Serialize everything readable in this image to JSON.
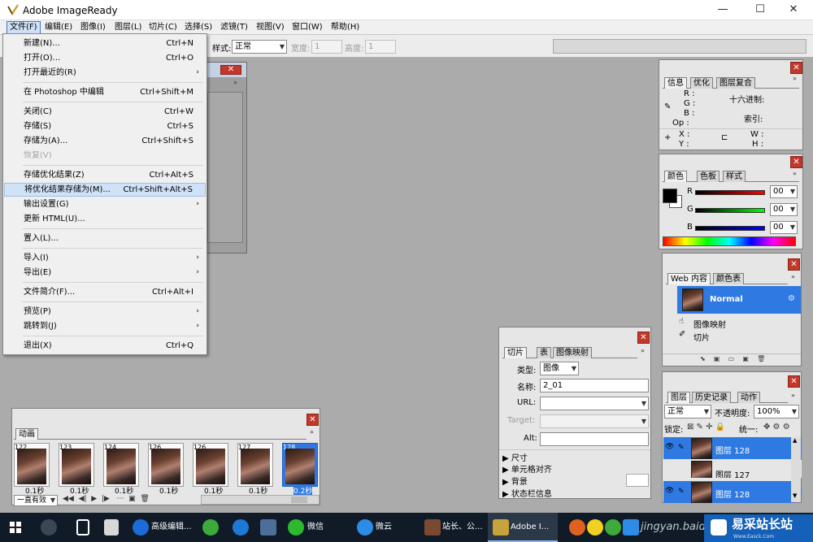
{
  "window": {
    "title": "Adobe ImageReady",
    "min": "—",
    "max": "☐",
    "close": "✕"
  },
  "menubar": [
    "文件(F)",
    "编辑(E)",
    "图像(I)",
    "图层(L)",
    "切片(C)",
    "选择(S)",
    "滤镜(T)",
    "视图(V)",
    "窗口(W)",
    "帮助(H)"
  ],
  "options": {
    "style_label": "样式:",
    "style_value": "正常",
    "width_label": "宽度:",
    "width_value": "1",
    "height_label": "高度:",
    "height_value": "1"
  },
  "file_menu": [
    {
      "label": "新建(N)...",
      "shortcut": "Ctrl+N"
    },
    {
      "label": "打开(O)...",
      "shortcut": "Ctrl+O"
    },
    {
      "label": "打开最近的(R)",
      "arrow": "›"
    },
    {
      "label": "在 Photoshop 中编辑",
      "shortcut": "Ctrl+Shift+M"
    },
    {
      "label": "关闭(C)",
      "shortcut": "Ctrl+W"
    },
    {
      "label": "存储(S)",
      "shortcut": "Ctrl+S"
    },
    {
      "label": "存储为(A)...",
      "shortcut": "Ctrl+Shift+S"
    },
    {
      "label": "恢复(V)"
    },
    {
      "label": "存储优化结果(Z)",
      "shortcut": "Ctrl+Alt+S"
    },
    {
      "label": "将优化结果存储为(M)...",
      "shortcut": "Ctrl+Shift+Alt+S"
    },
    {
      "label": "输出设置(G)",
      "arrow": "›"
    },
    {
      "label": "更新 HTML(U)..."
    },
    {
      "label": "置入(L)..."
    },
    {
      "label": "导入(I)",
      "arrow": "›"
    },
    {
      "label": "导出(E)",
      "arrow": "›"
    },
    {
      "label": "文件简介(F)...",
      "shortcut": "Ctrl+Alt+I"
    },
    {
      "label": "预览(P)",
      "arrow": "›"
    },
    {
      "label": "跳转到(J)",
      "arrow": "›"
    },
    {
      "label": "退出(X)",
      "shortcut": "Ctrl+Q"
    }
  ],
  "info_panel": {
    "tabs": [
      "信息",
      "优化",
      "图层复合"
    ],
    "r": "R :",
    "g": "G :",
    "b": "B :",
    "op": "Op :",
    "hex": "十六进制:",
    "index": "索引:",
    "x": "X :",
    "y": "Y :",
    "w": "W :",
    "h": "H :"
  },
  "color_panel": {
    "tabs": [
      "颜色",
      "色板",
      "样式"
    ],
    "r_label": "R",
    "g_label": "G",
    "b_label": "B",
    "r_value": "00",
    "g_value": "00",
    "b_value": "00"
  },
  "web_panel": {
    "tabs": [
      "Web 内容",
      "颜色表"
    ],
    "normal": "Normal",
    "image_map": "图像映射",
    "slice": "切片"
  },
  "layers_panel": {
    "tabs": [
      "图层",
      "历史记录",
      "动作"
    ],
    "blend": "正常",
    "opacity_label": "不透明度:",
    "opacity_value": "100%",
    "lock_label": "锁定:",
    "unify_label": "统一:",
    "layers": [
      "图层 128",
      "图层 127",
      "图层 128"
    ]
  },
  "slice_panel": {
    "tabs": [
      "切片",
      "表",
      "图像映射"
    ],
    "type_label": "类型:",
    "type_value": "图像",
    "name_label": "名称:",
    "name_value": "2_01",
    "url_label": "URL:",
    "target_label": "Target:",
    "alt_label": "Alt:",
    "sections": [
      "尺寸",
      "单元格对齐",
      "背景",
      "状态栏信息"
    ]
  },
  "animation_panel": {
    "tab": "动画",
    "loop": "一直有效",
    "frames": [
      {
        "num": "122",
        "delay": "0.1秒"
      },
      {
        "num": "123",
        "delay": "0.1秒"
      },
      {
        "num": "124",
        "delay": "0.1秒"
      },
      {
        "num": "126",
        "delay": "0.1秒"
      },
      {
        "num": "126",
        "delay": "0.1秒"
      },
      {
        "num": "127",
        "delay": "0.1秒"
      },
      {
        "num": "128",
        "delay": "0.2秒"
      }
    ]
  },
  "taskbar": {
    "items": [
      "高级编辑...",
      "微信",
      "微云",
      "站长、公...",
      "Adobe I..."
    ],
    "watermark": "jingyan.baidu.com",
    "brand": "易采站长站",
    "brand_sub": "Www.Easck.Com"
  }
}
